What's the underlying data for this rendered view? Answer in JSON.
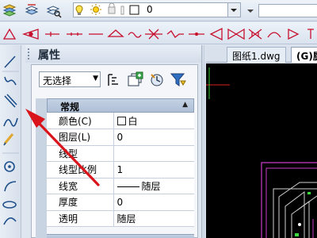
{
  "toolbar": {
    "layer_value": "0",
    "color_field": ""
  },
  "properties": {
    "title": "属性",
    "selection": "无选择",
    "section_general": "常规",
    "rows": [
      {
        "label": "颜色(C)",
        "value": "白",
        "kind": "color"
      },
      {
        "label": "图层(L)",
        "value": "0",
        "kind": "text"
      },
      {
        "label": "线型",
        "value": "",
        "kind": "text"
      },
      {
        "label": "线型比例",
        "value": "1",
        "kind": "text"
      },
      {
        "label": "线宽",
        "value": "随层",
        "kind": "lineweight"
      },
      {
        "label": "厚度",
        "value": "0",
        "kind": "text"
      },
      {
        "label": "透明",
        "value": "随层",
        "kind": "text"
      }
    ]
  },
  "tabs": [
    {
      "label": "图纸1.dwg"
    },
    {
      "label": "(G)厨"
    }
  ],
  "colors": {
    "arrow": "#d9141b",
    "canvas": "#000000",
    "accent": "#c8102e"
  }
}
